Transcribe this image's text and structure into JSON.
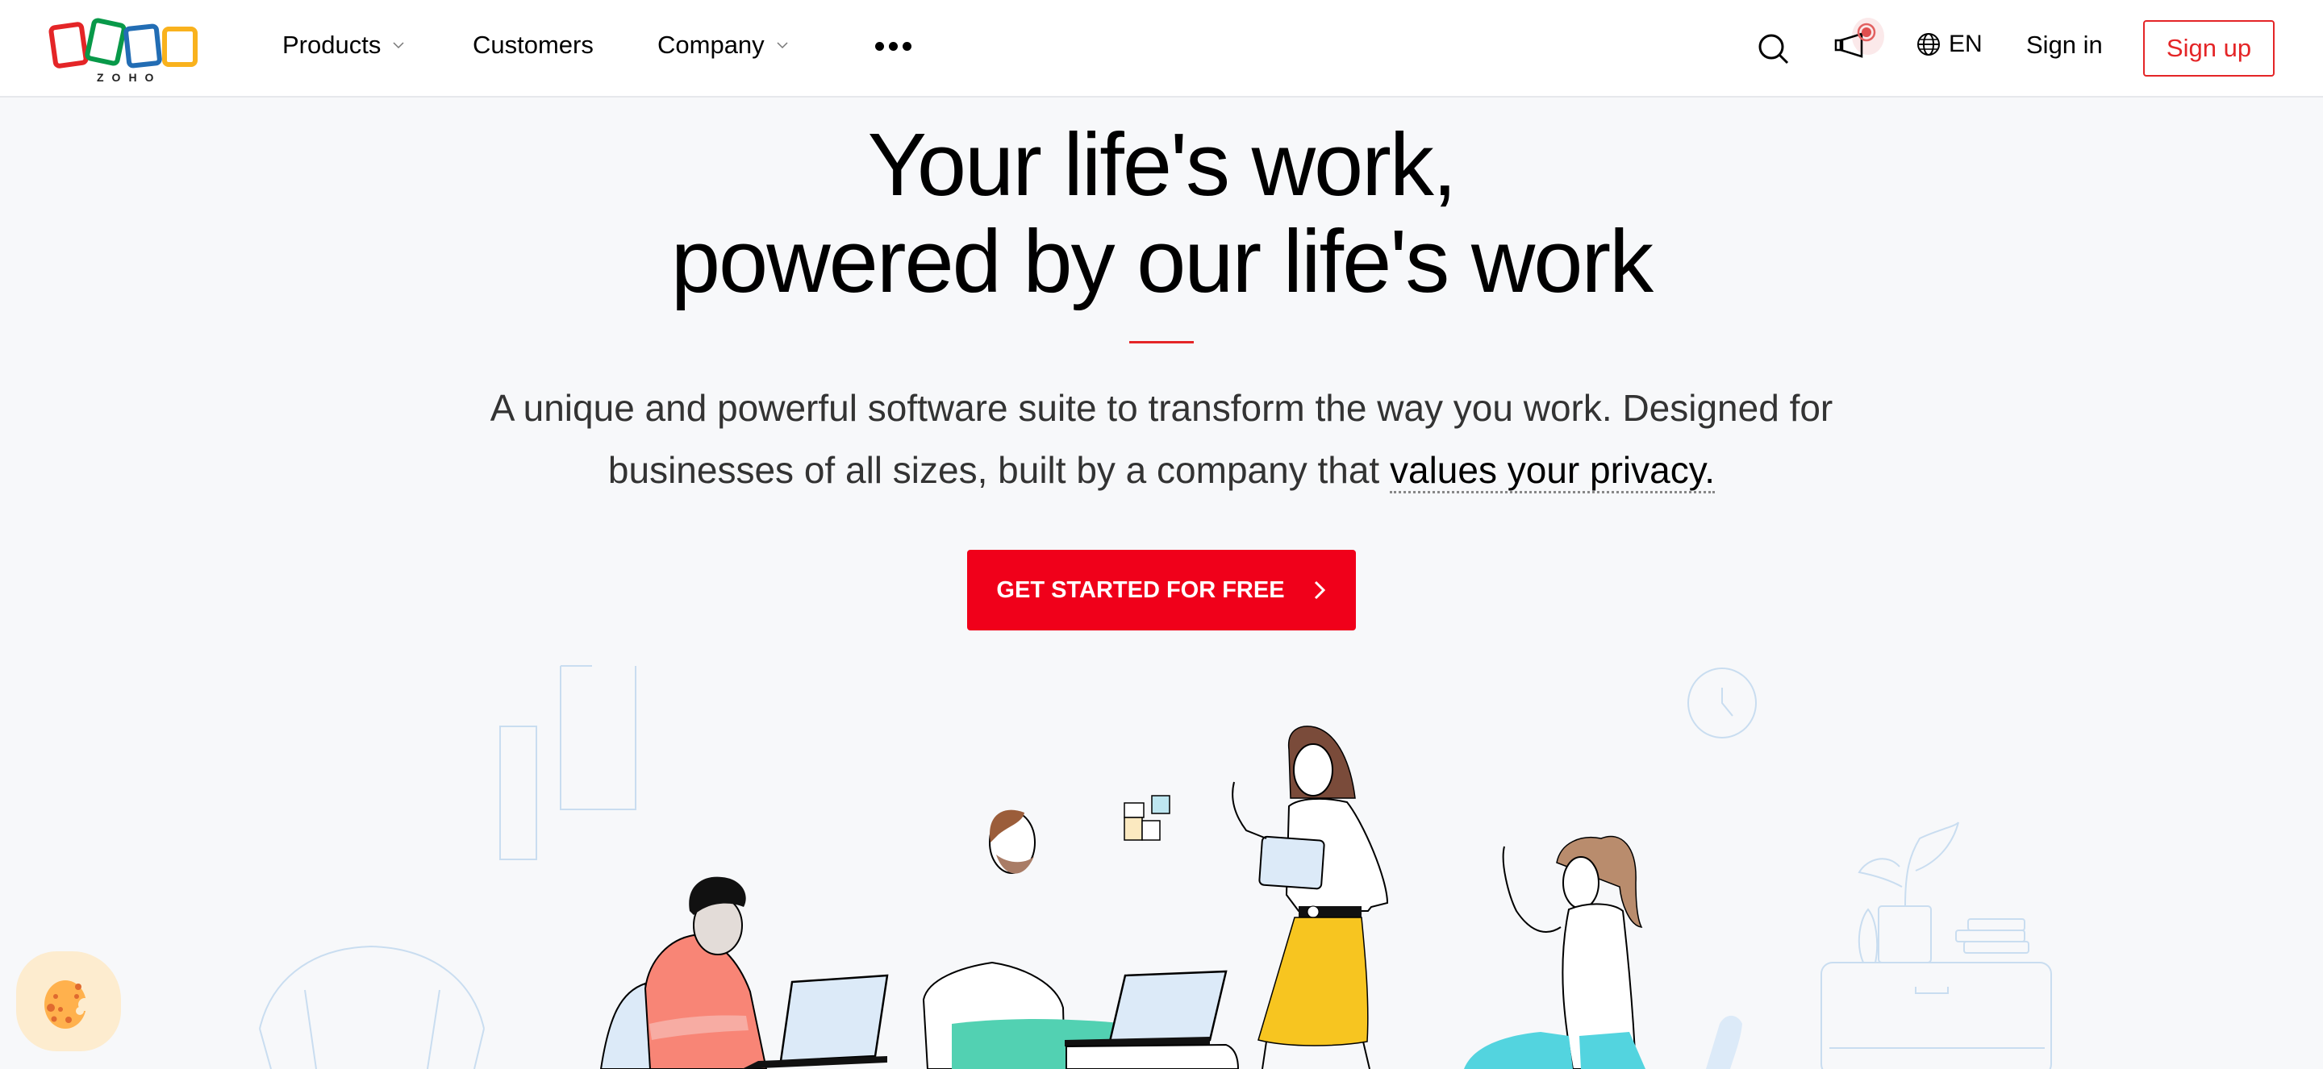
{
  "brand": {
    "name": "ZOHO",
    "logo_colors": [
      "#e42527",
      "#089949",
      "#226db4",
      "#f9b21d"
    ]
  },
  "nav": {
    "items": [
      {
        "label": "Products",
        "has_dropdown": true
      },
      {
        "label": "Customers",
        "has_dropdown": false
      },
      {
        "label": "Company",
        "has_dropdown": true
      }
    ],
    "more_icon": "more-dots-icon",
    "search_icon": "search-icon",
    "announce_icon": "megaphone-icon",
    "language": {
      "icon": "globe-icon",
      "label": "EN"
    },
    "sign_in": "Sign in",
    "sign_up": "Sign up"
  },
  "hero": {
    "title_line1": "Your life's work,",
    "title_line2": "powered by our life's work",
    "subtitle_line1": "A unique and powerful software suite to transform the way you work. Designed for",
    "subtitle_line2_prefix": "businesses of all sizes, built by a company that ",
    "subtitle_link": "values your privacy.",
    "cta_label": "GET STARTED FOR FREE",
    "cta_icon": "chevron-right-icon"
  },
  "colors": {
    "accent": "#e42527",
    "cta": "#f0001a",
    "background": "#f7f8fa",
    "illustration_line": "#c9ddf0"
  },
  "cookie_widget": {
    "icon": "cookie-icon"
  }
}
